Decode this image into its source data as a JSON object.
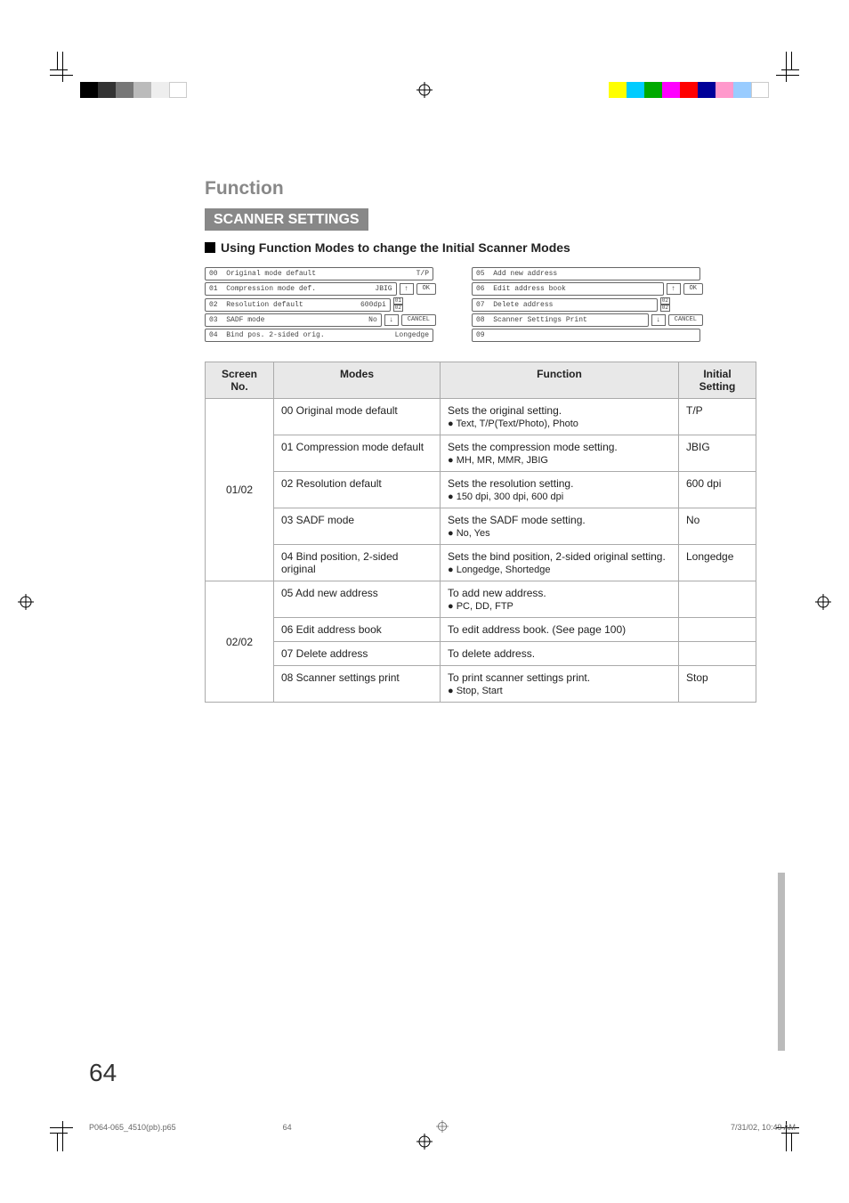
{
  "page": {
    "section_label": "Function",
    "title_bar": "SCANNER SETTINGS",
    "subtitle": "Using Function Modes to change the Initial Scanner Modes",
    "page_number": "64",
    "footer_file": "P064-065_4510(pb).p65",
    "footer_page": "64",
    "footer_date": "7/31/02, 10:49 AM"
  },
  "screen1": {
    "rows": [
      {
        "num": "00",
        "label": "Original mode default",
        "val": "T/P"
      },
      {
        "num": "01",
        "label": "Compression mode def.",
        "val": "JBIG"
      },
      {
        "num": "02",
        "label": "Resolution default",
        "val": "600dpi"
      },
      {
        "num": "03",
        "label": "SADF mode",
        "val": "No"
      },
      {
        "num": "04",
        "label": "Bind pos. 2-sided orig.",
        "val": "Longedge"
      }
    ],
    "ok": "OK",
    "cancel": "CANCEL",
    "pager_top": "01",
    "pager_bot": "02"
  },
  "screen2": {
    "rows": [
      {
        "num": "05",
        "label": "Add new address",
        "val": ""
      },
      {
        "num": "06",
        "label": "Edit address book",
        "val": ""
      },
      {
        "num": "07",
        "label": "Delete address",
        "val": ""
      },
      {
        "num": "08",
        "label": "Scanner Settings Print",
        "val": ""
      },
      {
        "num": "09",
        "label": "",
        "val": ""
      }
    ],
    "ok": "OK",
    "cancel": "CANCEL",
    "pager_top": "02",
    "pager_bot": "02"
  },
  "table": {
    "headers": {
      "screen": "Screen\nNo.",
      "modes": "Modes",
      "function": "Function",
      "initial": "Initial\nSetting"
    },
    "groups": [
      {
        "screen_no": "01/02",
        "rows": [
          {
            "mode": "00 Original mode default",
            "func": "Sets the original setting.",
            "opts": "Text, T/P(Text/Photo), Photo",
            "init": "T/P"
          },
          {
            "mode": "01 Compression mode default",
            "func": "Sets the compression mode setting.",
            "opts": "MH, MR, MMR, JBIG",
            "init": "JBIG"
          },
          {
            "mode": "02 Resolution default",
            "func": "Sets the resolution setting.",
            "opts": "150 dpi, 300 dpi, 600 dpi",
            "init": "600 dpi"
          },
          {
            "mode": "03 SADF mode",
            "func": "Sets the SADF mode setting.",
            "opts": "No, Yes",
            "init": "No"
          },
          {
            "mode": "04 Bind position, 2-sided original",
            "func": "Sets the bind position, 2-sided original setting.",
            "opts": "Longedge, Shortedge",
            "init": "Longedge"
          }
        ]
      },
      {
        "screen_no": "02/02",
        "rows": [
          {
            "mode": "05 Add new address",
            "func": "To add new address.",
            "opts": "PC, DD, FTP",
            "init": ""
          },
          {
            "mode": "06 Edit address book",
            "func": "To edit address book. (See page 100)",
            "opts": "",
            "init": ""
          },
          {
            "mode": "07 Delete address",
            "func": "To delete address.",
            "opts": "",
            "init": ""
          },
          {
            "mode": "08 Scanner settings print",
            "func": "To print scanner settings print.",
            "opts": "Stop, Start",
            "init": "Stop"
          }
        ]
      }
    ]
  }
}
